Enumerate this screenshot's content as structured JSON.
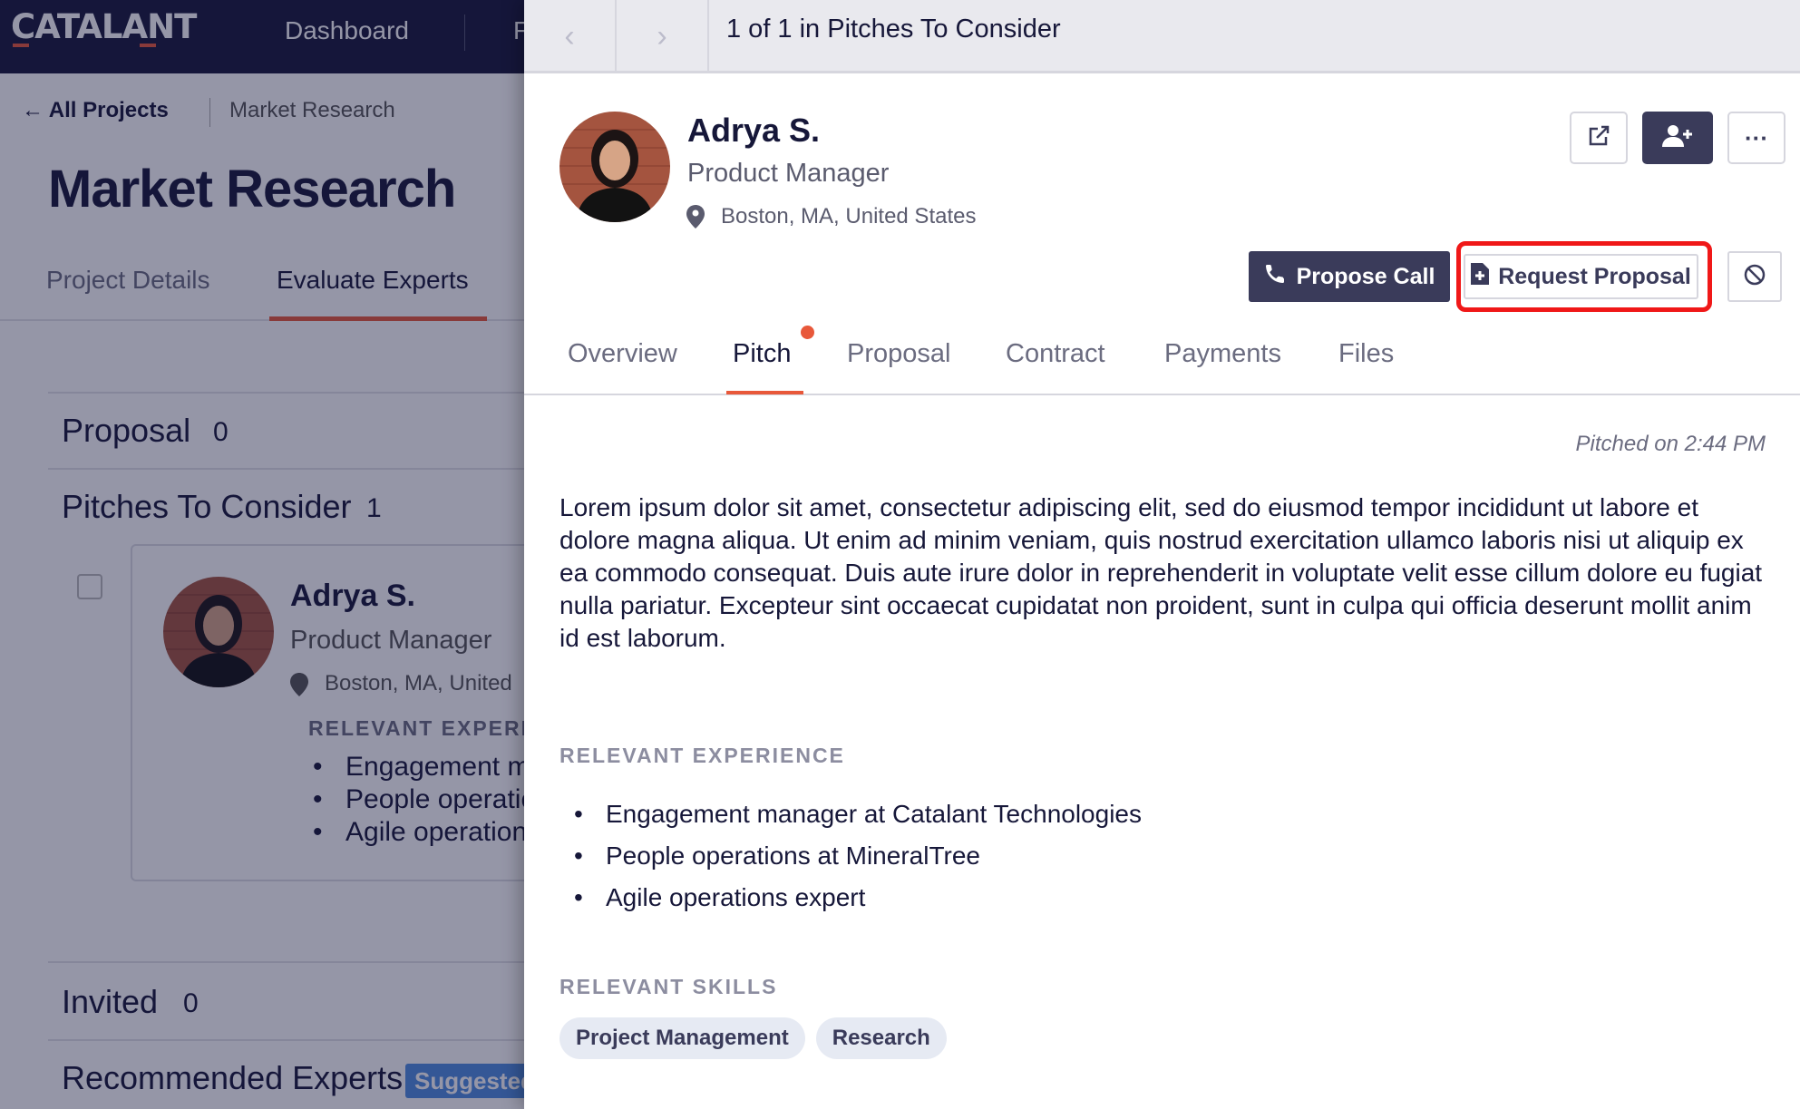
{
  "app": {
    "logo": "CATALANT",
    "nav": [
      "Dashboard",
      "F"
    ]
  },
  "background": {
    "breadcrumb_back": "← All Projects",
    "breadcrumb_current": "Market Research",
    "title": "Market Research",
    "tabs": [
      "Project Details",
      "Evaluate Experts"
    ],
    "sections": {
      "proposal": {
        "label": "Proposal",
        "count": "0"
      },
      "pitches": {
        "label": "Pitches To Consider",
        "count": "1"
      },
      "invited": {
        "label": "Invited",
        "count": "0"
      },
      "recommended": {
        "label": "Recommended Experts",
        "badge": "Suggested"
      }
    },
    "card": {
      "name": "Adrya S.",
      "role": "Product Manager",
      "location": "Boston, MA, United",
      "experience_label": "RELEVANT EXPERI",
      "experience": [
        "Engagement m",
        "People operatio",
        "Agile operation"
      ]
    }
  },
  "drawer": {
    "position_text": "1 of 1 in Pitches To Consider",
    "expert": {
      "name": "Adrya S.",
      "role": "Product Manager",
      "location": "Boston, MA, United States"
    },
    "actions": {
      "propose_call": "Propose Call",
      "request_proposal": "Request Proposal"
    },
    "tabs": [
      "Overview",
      "Pitch",
      "Proposal",
      "Contract",
      "Payments",
      "Files"
    ],
    "active_tab": "Pitch",
    "pitched_on": "Pitched on 2:44 PM",
    "pitch_text": "Lorem ipsum dolor sit amet, consectetur adipiscing elit, sed do eiusmod tempor incididunt ut labore et dolore magna aliqua. Ut enim ad minim veniam, quis nostrud exercitation ullamco laboris nisi ut aliquip ex ea commodo consequat. Duis aute irure dolor in reprehenderit in voluptate velit esse cillum dolore eu fugiat nulla pariatur. Excepteur sint occaecat cupidatat non proident, sunt in culpa qui officia deserunt mollit anim id est laborum.",
    "experience_label": "RELEVANT EXPERIENCE",
    "experience": [
      "Engagement manager at Catalant Technologies",
      "People operations at MineralTree",
      "Agile operations expert"
    ],
    "skills_label": "RELEVANT SKILLS",
    "skills": [
      "Project Management",
      "Research"
    ]
  },
  "colors": {
    "navy": "#161739",
    "accent": "#e8583a",
    "button_dark": "#3a3b5a",
    "highlight": "#f01818",
    "badge": "#4f8de0"
  },
  "icons": [
    "external-link-icon",
    "add-user-icon",
    "more-icon",
    "phone-icon",
    "document-plus-icon",
    "block-icon",
    "location-pin-icon",
    "chevron-left-icon",
    "chevron-right-icon"
  ]
}
